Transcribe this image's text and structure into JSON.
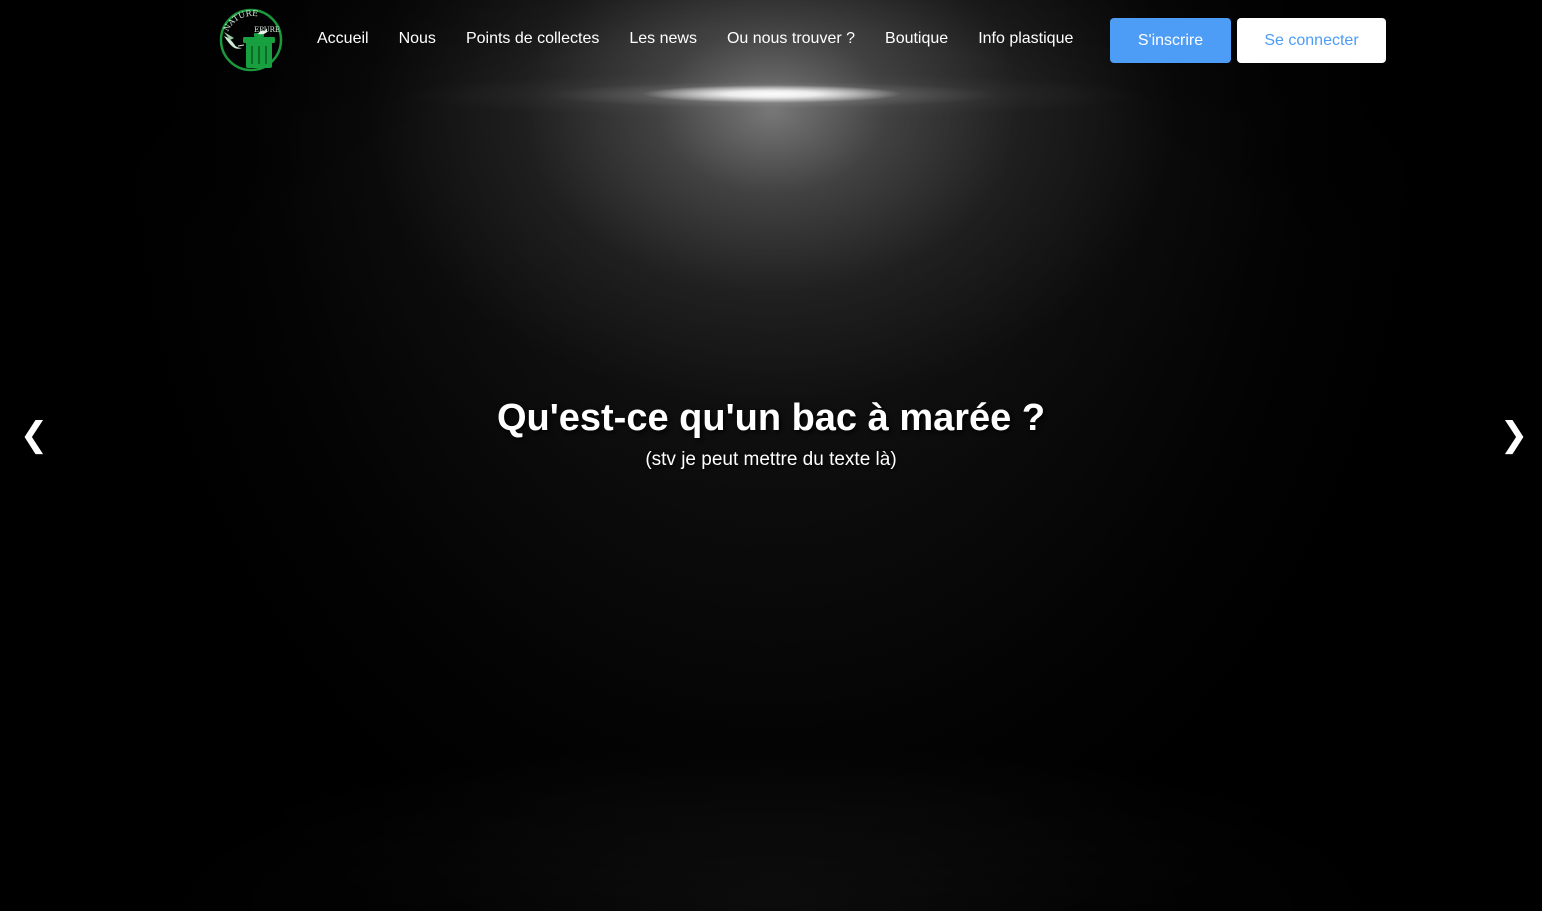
{
  "header": {
    "logo_text_line1": "NATURE",
    "logo_text_line2": "EPURE",
    "nav": [
      {
        "label": "Accueil"
      },
      {
        "label": "Nous"
      },
      {
        "label": "Points de collectes"
      },
      {
        "label": "Les news"
      },
      {
        "label": "Ou nous trouver ?"
      },
      {
        "label": "Boutique"
      },
      {
        "label": "Info plastique"
      }
    ],
    "signup_label": "S'inscrire",
    "login_label": "Se connecter"
  },
  "hero": {
    "title": "Qu'est-ce qu'un bac à marée ?",
    "subtitle": "(stv je peut mettre du texte là)",
    "prev_arrow": "❮",
    "next_arrow": "❯"
  },
  "colors": {
    "background": "#000000",
    "accent": "#4d9cf5",
    "logo_green": "#1a9a3c"
  },
  "icons": {
    "logo": "nature-epure-logo",
    "prev": "chevron-left-icon",
    "next": "chevron-right-icon"
  }
}
